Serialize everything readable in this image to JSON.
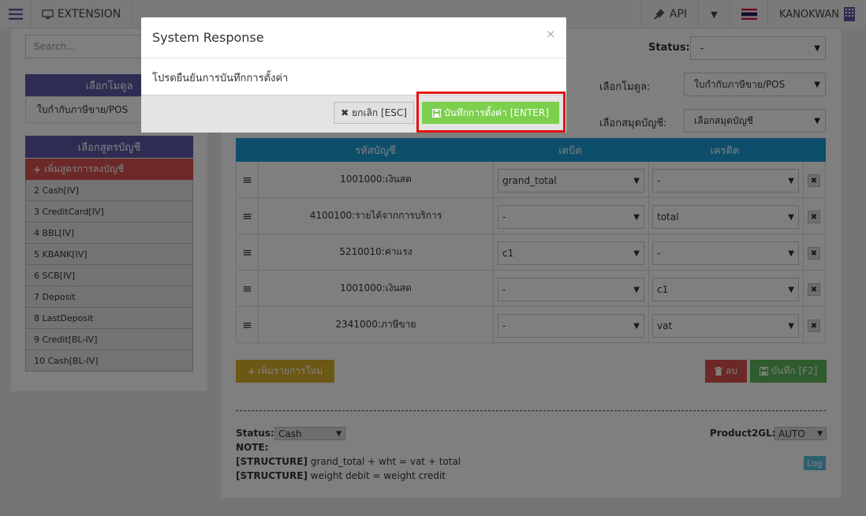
{
  "topbar": {
    "extension_label": "EXTENSION",
    "api_label": "API",
    "user_name": "KANOKWAN"
  },
  "sidebar": {
    "search_placeholder": "Search...",
    "module_header": "เลือกโมดูล",
    "module_item": "ใบกำกับภาษีขาย/POS",
    "formula_header": "เลือกสูตรบัญชี",
    "add_formula": "เพิ่มสูตรการลงบัญชี",
    "formulas": [
      "2 Cash[IV]",
      "3 CreditCard[IV]",
      "4 BBL[IV]",
      "5 KBANK[IV]",
      "6 SCB[IV]",
      "7 Deposit",
      "8 LastDeposit",
      "9 Credit[BL-IV]",
      "10 Cash[BL-IV]"
    ]
  },
  "form": {
    "status_label": "Status:",
    "status_value": "-",
    "module_label": "เลือกโมดูล:",
    "module_value": "ใบกำกับภาษีขาย/POS",
    "book_label": "เลือกสมุดบัญชี:",
    "book_value": "เลือกสมุดบัญชี"
  },
  "table": {
    "headers": [
      "รหัสบัญชี",
      "เดบิต",
      "เครดิต"
    ],
    "rows": [
      {
        "account": "1001000:เงินสด",
        "debit": "grand_total",
        "credit": "-"
      },
      {
        "account": "4100100:รายได้จากการบริการ",
        "debit": "-",
        "credit": "total"
      },
      {
        "account": "5210010:ค่าแรง",
        "debit": "c1",
        "credit": "-"
      },
      {
        "account": "1001000:เงินสด",
        "debit": "-",
        "credit": "c1"
      },
      {
        "account": "2341000:ภาษีขาย",
        "debit": "-",
        "credit": "vat"
      }
    ]
  },
  "actions": {
    "add_row": "เพิ่มรายการใหม่",
    "delete": "ลบ",
    "save": "บันทึก [F2]"
  },
  "footer": {
    "status_label": "Status:",
    "status_value": "Cash",
    "product2gl_label": "Product2GL:",
    "product2gl_value": "AUTO",
    "note_label": "NOTE:",
    "structure_tag": "[STRUCTURE]",
    "structure1": "grand_total + wht = vat + total",
    "structure2": "weight debit = weight credit",
    "log_label": "Log"
  },
  "modal": {
    "title": "System Response",
    "message": "โปรดยืนยันการบันทึกการตั้งค่า",
    "cancel_label": "ยกเลิก [ESC]",
    "confirm_label": "บันทึกการตั้งค่า [ENTER]",
    "close_glyph": "×"
  }
}
